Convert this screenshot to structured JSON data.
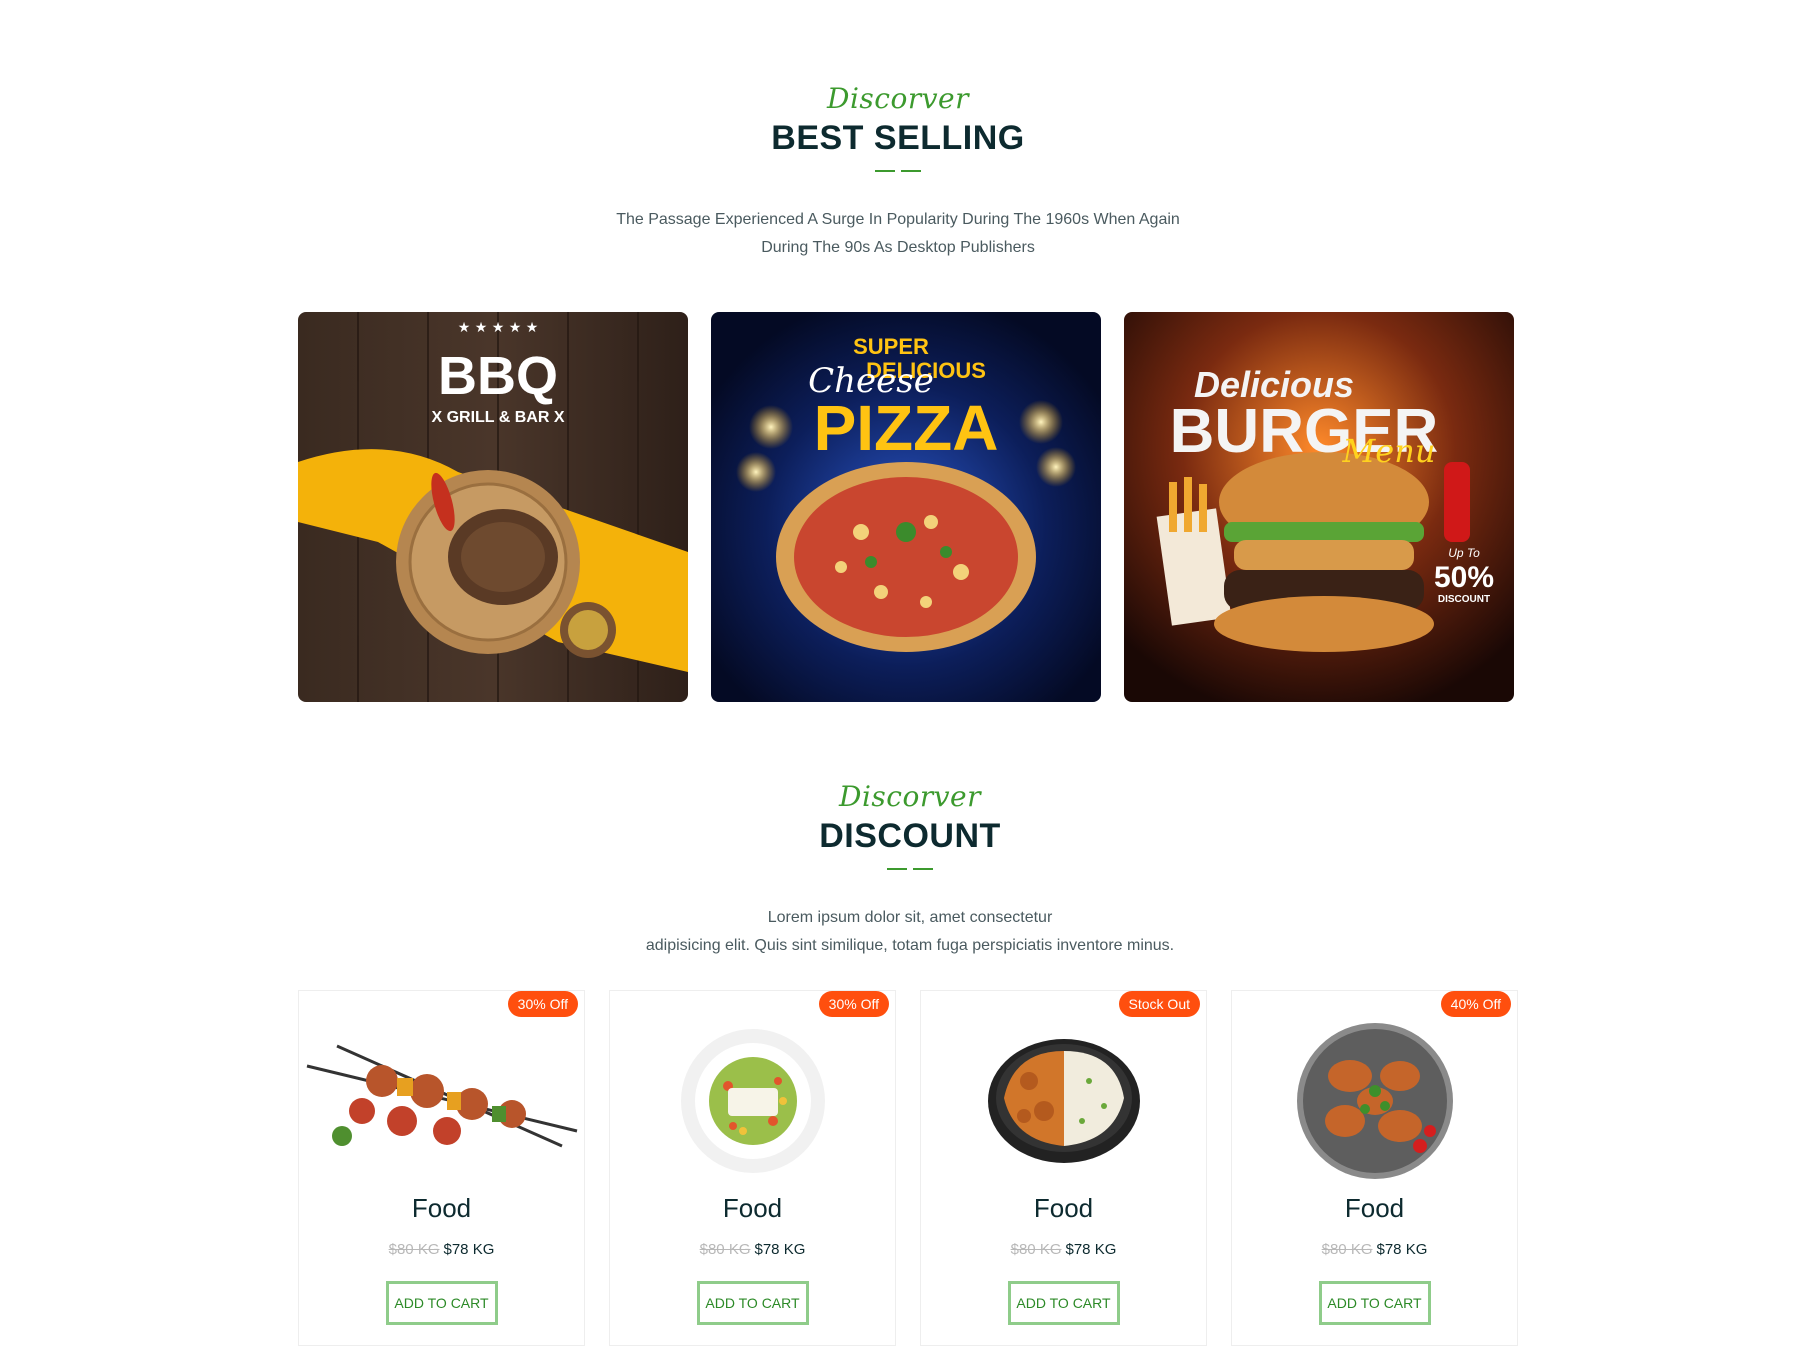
{
  "best_selling": {
    "eyebrow": "Discorver",
    "title": "BEST SELLING",
    "subtitle_line1": "The Passage Experienced A Surge In Popularity During The 1960s When Again",
    "subtitle_line2": "During The 90s As Desktop Publishers",
    "banners": [
      {
        "name": "bbq-banner",
        "headline": "BBQ",
        "tagline": "X GRILL & BAR X"
      },
      {
        "name": "pizza-banner",
        "line1": "SUPER",
        "line2": "DELICIOUS",
        "script": "Cheese",
        "headline": "PIZZA"
      },
      {
        "name": "burger-banner",
        "line1": "Delicious",
        "headline": "BURGER",
        "script": "Menu",
        "promo_small": "Up To",
        "promo_big": "50%",
        "promo_label": "DISCOUNT"
      }
    ]
  },
  "discount": {
    "eyebrow": "Discorver",
    "title": "DISCOUNT",
    "subtitle_line1": "Lorem ipsum dolor sit, amet consectetur",
    "subtitle_line2": "adipisicing elit. Quis sint similique, totam fuga perspiciatis inventore minus.",
    "products": [
      {
        "badge": "30% Off",
        "name": "Food",
        "old_price": "$80 KG",
        "price": "$78 KG",
        "button": "ADD TO CART",
        "image": "skewers"
      },
      {
        "badge": "30% Off",
        "name": "Food",
        "old_price": "$80 KG",
        "price": "$78 KG",
        "button": "ADD TO CART",
        "image": "salad-plate"
      },
      {
        "badge": "Stock Out",
        "name": "Food",
        "old_price": "$80 KG",
        "price": "$78 KG",
        "button": "ADD TO CART",
        "image": "curry-rice-bowl"
      },
      {
        "badge": "40% Off",
        "name": "Food",
        "old_price": "$80 KG",
        "price": "$78 KG",
        "button": "ADD TO CART",
        "image": "fried-chicken-plate"
      }
    ]
  },
  "colors": {
    "accent_green": "#3c9a2e",
    "badge_orange": "#ff4f0e",
    "heading": "#0d2a2f"
  }
}
